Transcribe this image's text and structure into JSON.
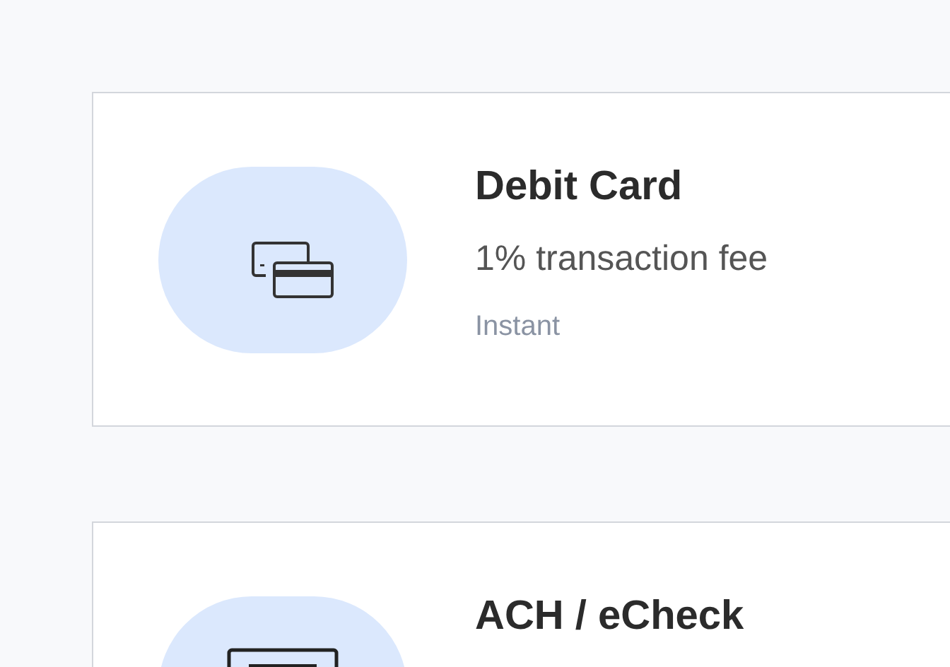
{
  "methods": [
    {
      "kind": "card",
      "title": "Debit Card",
      "fee": "1% transaction fee",
      "speed": "Instant"
    },
    {
      "kind": "check",
      "title": "ACH / eCheck"
    }
  ]
}
